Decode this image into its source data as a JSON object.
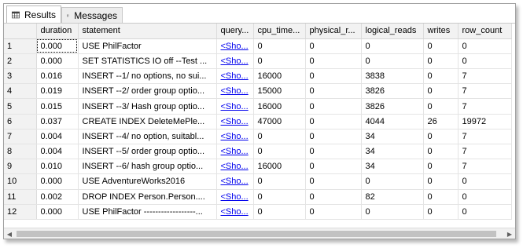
{
  "tabs": [
    {
      "label": "Results",
      "icon": "grid-icon",
      "active": true
    },
    {
      "label": "Messages",
      "icon": "messages-icon",
      "active": false
    }
  ],
  "grid": {
    "columns": [
      "",
      "duration",
      "statement",
      "query...",
      "cpu_time...",
      "physical_r...",
      "logical_reads",
      "writes",
      "row_count"
    ],
    "rows": [
      [
        "1",
        "0.000",
        "USE PhilFactor",
        "<Sho...",
        "0",
        "0",
        "0",
        "0",
        "0"
      ],
      [
        "2",
        "0.000",
        "SET STATISTICS IO off --Test ...",
        "<Sho...",
        "0",
        "0",
        "0",
        "0",
        "0"
      ],
      [
        "3",
        "0.016",
        "INSERT --1/ no options, no sui...",
        "<Sho...",
        "16000",
        "0",
        "3838",
        "0",
        "7"
      ],
      [
        "4",
        "0.019",
        "INSERT --2/ order group optio...",
        "<Sho...",
        "15000",
        "0",
        "3826",
        "0",
        "7"
      ],
      [
        "5",
        "0.015",
        "INSERT --3/ Hash group optio...",
        "<Sho...",
        "16000",
        "0",
        "3826",
        "0",
        "7"
      ],
      [
        "6",
        "0.037",
        "CREATE INDEX DeleteMePle...",
        "<Sho...",
        "47000",
        "0",
        "4044",
        "26",
        "19972"
      ],
      [
        "7",
        "0.004",
        "INSERT --4/ no option, suitabl...",
        "<Sho...",
        "0",
        "0",
        "34",
        "0",
        "7"
      ],
      [
        "8",
        "0.004",
        "INSERT --5/ order group optio...",
        "<Sho...",
        "0",
        "0",
        "34",
        "0",
        "7"
      ],
      [
        "9",
        "0.010",
        "INSERT --6/ hash group optio...",
        "<Sho...",
        "16000",
        "0",
        "34",
        "0",
        "7"
      ],
      [
        "10",
        "0.000",
        "USE AdventureWorks2016",
        "<Sho...",
        "0",
        "0",
        "0",
        "0",
        "0"
      ],
      [
        "11",
        "0.002",
        "DROP INDEX Person.Person....",
        "<Sho...",
        "0",
        "0",
        "82",
        "0",
        "0"
      ],
      [
        "12",
        "0.000",
        "USE PhilFactor ------------------...",
        "<Sho...",
        "0",
        "0",
        "0",
        "0",
        "0"
      ]
    ]
  },
  "scrollbar": {
    "left_arrow": "scroll-left-icon",
    "right_arrow": "scroll-right-icon"
  }
}
